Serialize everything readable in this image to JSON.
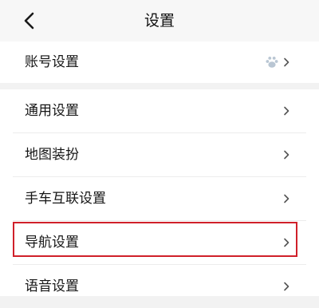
{
  "header": {
    "title": "设置",
    "back_icon": "chevron-left-icon"
  },
  "account": {
    "label": "账号设置",
    "avatar_icon": "paw-avatar-icon",
    "chevron_icon": "chevron-right-icon"
  },
  "settings": {
    "items": [
      {
        "label": "通用设置",
        "chevron_icon": "chevron-right-icon"
      },
      {
        "label": "地图装扮",
        "chevron_icon": "chevron-right-icon"
      },
      {
        "label": "手车互联设置",
        "chevron_icon": "chevron-right-icon"
      },
      {
        "label": "导航设置",
        "chevron_icon": "chevron-right-icon",
        "highlighted": true
      },
      {
        "label": "语音设置",
        "chevron_icon": "chevron-right-icon"
      }
    ]
  },
  "colors": {
    "highlight_border": "#d0202a",
    "background": "#f2f2f2",
    "card": "#ffffff",
    "chevron": "#555555"
  }
}
